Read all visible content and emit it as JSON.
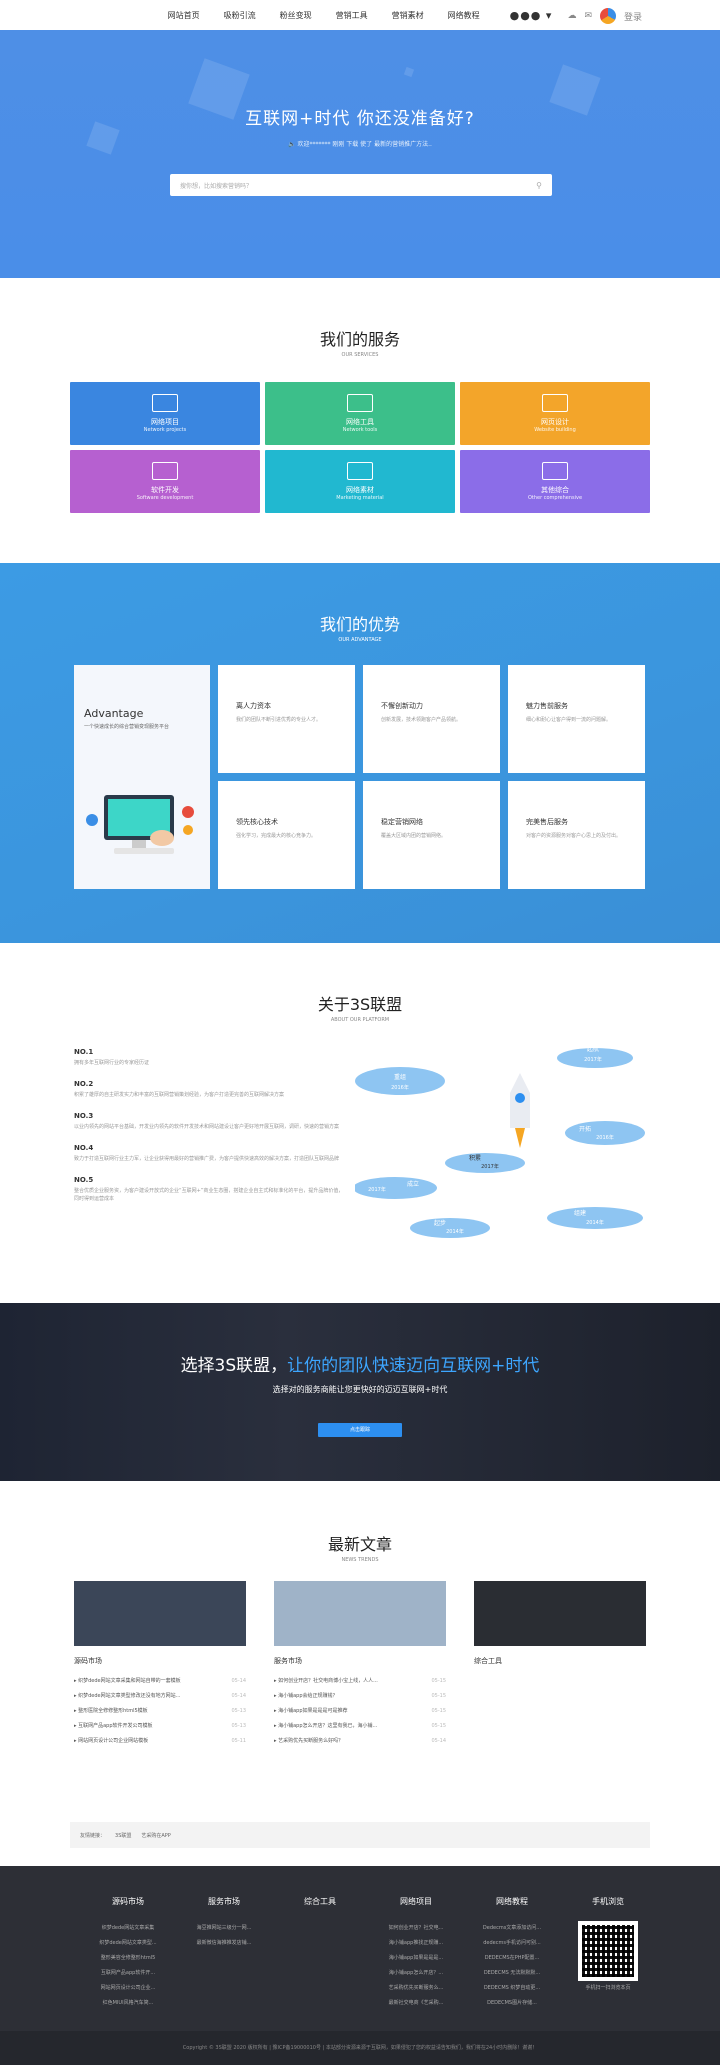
{
  "nav": {
    "items": [
      "网站首页",
      "吸粉引流",
      "粉丝变现",
      "营销工具",
      "营销素材",
      "网络教程"
    ],
    "more": "●●● ▾",
    "user": "登录"
  },
  "hero": {
    "title": "互联网+时代 你还没准备好?",
    "announce": "🔈 欢迎******* 刚刚 下载 使了 最新的营销推广方法..",
    "search_placeholder": "搜你想，比如搜索营销吗？"
  },
  "services": {
    "title": "我们的服务",
    "subtitle": "OUR SERVICES",
    "cards": [
      {
        "name": "网络项目",
        "en": "Network projects",
        "color": "#3a86e0"
      },
      {
        "name": "网络工具",
        "en": "Network tools",
        "color": "#3cbf8a"
      },
      {
        "name": "网页设计",
        "en": "Website building",
        "color": "#f3a52a"
      },
      {
        "name": "软件开发",
        "en": "Software development",
        "color": "#b660d0"
      },
      {
        "name": "网络素材",
        "en": "Marketing material",
        "color": "#21b8d0"
      },
      {
        "name": "其他综合",
        "en": "Other comprehensive",
        "color": "#8b6de8"
      }
    ]
  },
  "advantage": {
    "title": "我们的优势",
    "subtitle": "OUR ADVANTAGE",
    "left_title": "Advantage",
    "left_sub": "一个快速成长的综合营销变现服务平台",
    "cells": [
      {
        "t": "离人力资本",
        "d": "我们的团队不断引进优秀的专业人才。"
      },
      {
        "t": "不懈创新动力",
        "d": "创新发展，技术领跑客户产品领航。"
      },
      {
        "t": "魅力售前服务",
        "d": "细心和耐心让客户得到一流的问题解。"
      },
      {
        "t": "领先核心技术",
        "d": "强化学习，完成最大的核心竞争力。"
      },
      {
        "t": "稳定营销网络",
        "d": "覆盖大区域内团的营销网络。"
      },
      {
        "t": "完美售后服务",
        "d": "对客户的资源服务对客户心思上的及付出。"
      }
    ]
  },
  "about": {
    "title": "关于3S联盟",
    "subtitle": "ABOUT OUR PLATFORM",
    "items": [
      {
        "no": "NO.1",
        "d": "拥有多年互联网行业的专家经历证"
      },
      {
        "no": "NO.2",
        "d": "积累了雄厚的自主研发实力和丰富的互联网营销策划经验，为客户打造更完善的互联网解决方案"
      },
      {
        "no": "NO.3",
        "d": "以业内领先的网站平台基础，开发业内领先的软件开发技术和网站建设让客户更好地开展互联网，调研，快速的营销方案"
      },
      {
        "no": "NO.4",
        "d": "致力于打造互联网行业主力军，让企业获得用最好的营销推广费，为客户提供快速高效的解决方案，打造团队互联网品牌"
      },
      {
        "no": "NO.5",
        "d": "整合优质企业服务资，为客户建设开放式的企业“互联网+”商业生态圈，搭建企业自主式和标准化的平台，提升品牌价值，同时得到运营成本"
      }
    ],
    "clouds": [
      {
        "t": "起航",
        "y": "2017年"
      },
      {
        "t": "重组",
        "y": "2016年"
      },
      {
        "t": "开拓",
        "y": "2016年"
      },
      {
        "t": "积累",
        "y": "2017年"
      },
      {
        "t": "成立",
        "y": "2017年"
      },
      {
        "t": "起步",
        "y": "2014年"
      },
      {
        "t": "组建",
        "y": "2014年"
      }
    ]
  },
  "cta": {
    "title_a": "选择3S联盟，",
    "title_b": "让你的团队快速迈向互联网+时代",
    "sub": "选择对的服务商能让您更快好的迈迈互联网+时代",
    "button": "点击跟踪"
  },
  "news": {
    "title": "最新文章",
    "subtitle": "NEWS TRENDS",
    "cols": [
      {
        "cat": "源码市场",
        "img": "#3b4658",
        "items": [
          [
            "织梦dede网站文章采集和网站自带的一套模板",
            "05-14"
          ],
          [
            "织梦dede网站文章类型修改还没有地方网站...",
            "05-14"
          ],
          [
            "整形医院全修修整形html5模板",
            "05-13"
          ],
          [
            "互联网产品app软件开发公司模板",
            "05-13"
          ],
          [
            "网站网页设计公司企业网站模板",
            "05-11"
          ]
        ]
      },
      {
        "cat": "服务市场",
        "img": "#9fb3c8",
        "items": [
          [
            "如何创业开店？社交电商博小宝上线，人人...",
            "05-15"
          ],
          [
            "海小铺app会给正规赚钱？",
            "05-15"
          ],
          [
            "海小铺app如果是是是可是推荐",
            "05-15"
          ],
          [
            "海小铺app怎么开店？这里有我已，海小铺...",
            "05-15"
          ],
          [
            "艺采购优先买断服务么好吗？",
            "05-14"
          ]
        ]
      },
      {
        "cat": "综合工具",
        "img": "#2a2d33",
        "items": []
      }
    ]
  },
  "links": {
    "label": "友情链接：",
    "items": [
      "3S联盟",
      "艺采购在APP"
    ]
  },
  "footer": {
    "cols": [
      {
        "h": "源码市场",
        "items": [
          "织梦dede网站文章采集",
          "织梦dede网站文章类型...",
          "整形美容全修整形html5",
          "互联网产品app软件开...",
          "网站网页设计公司企业...",
          "红色MIUI风格汽车简..."
        ]
      },
      {
        "h": "服务市场",
        "items": [
          "海豆推网站三级分一网...",
          "最新微信海推推发店铺..."
        ]
      },
      {
        "h": "综合工具",
        "items": []
      },
      {
        "h": "网络项目",
        "items": [
          "如何创业开店？社交电...",
          "海小铺app推找正规赚...",
          "海小铺app如果是是是...",
          "海小铺app怎么开店？...",
          "艺采购优先买断服务么...",
          "最新社交电商《艺采购..."
        ]
      },
      {
        "h": "网络教程",
        "items": [
          "Dedecms文章添加访问...",
          "dedecms手机访问可别...",
          "DEDECMS在PHP配置...",
          "DEDECMS 无法默默默...",
          "DEDECMS 织梦自动更...",
          "DEDECMS图片存储..."
        ]
      },
      {
        "h": "手机浏览",
        "items": [
          "手机扫一扫浏览本页"
        ]
      }
    ],
    "copy": "Copyright © 3S联盟  2020  版权所有 | 豫ICP备19000010号 | 本站部分资源来源于互联网，如果侵犯了您的权益请告知我们，我们将在24小时内删除！谢谢！"
  }
}
